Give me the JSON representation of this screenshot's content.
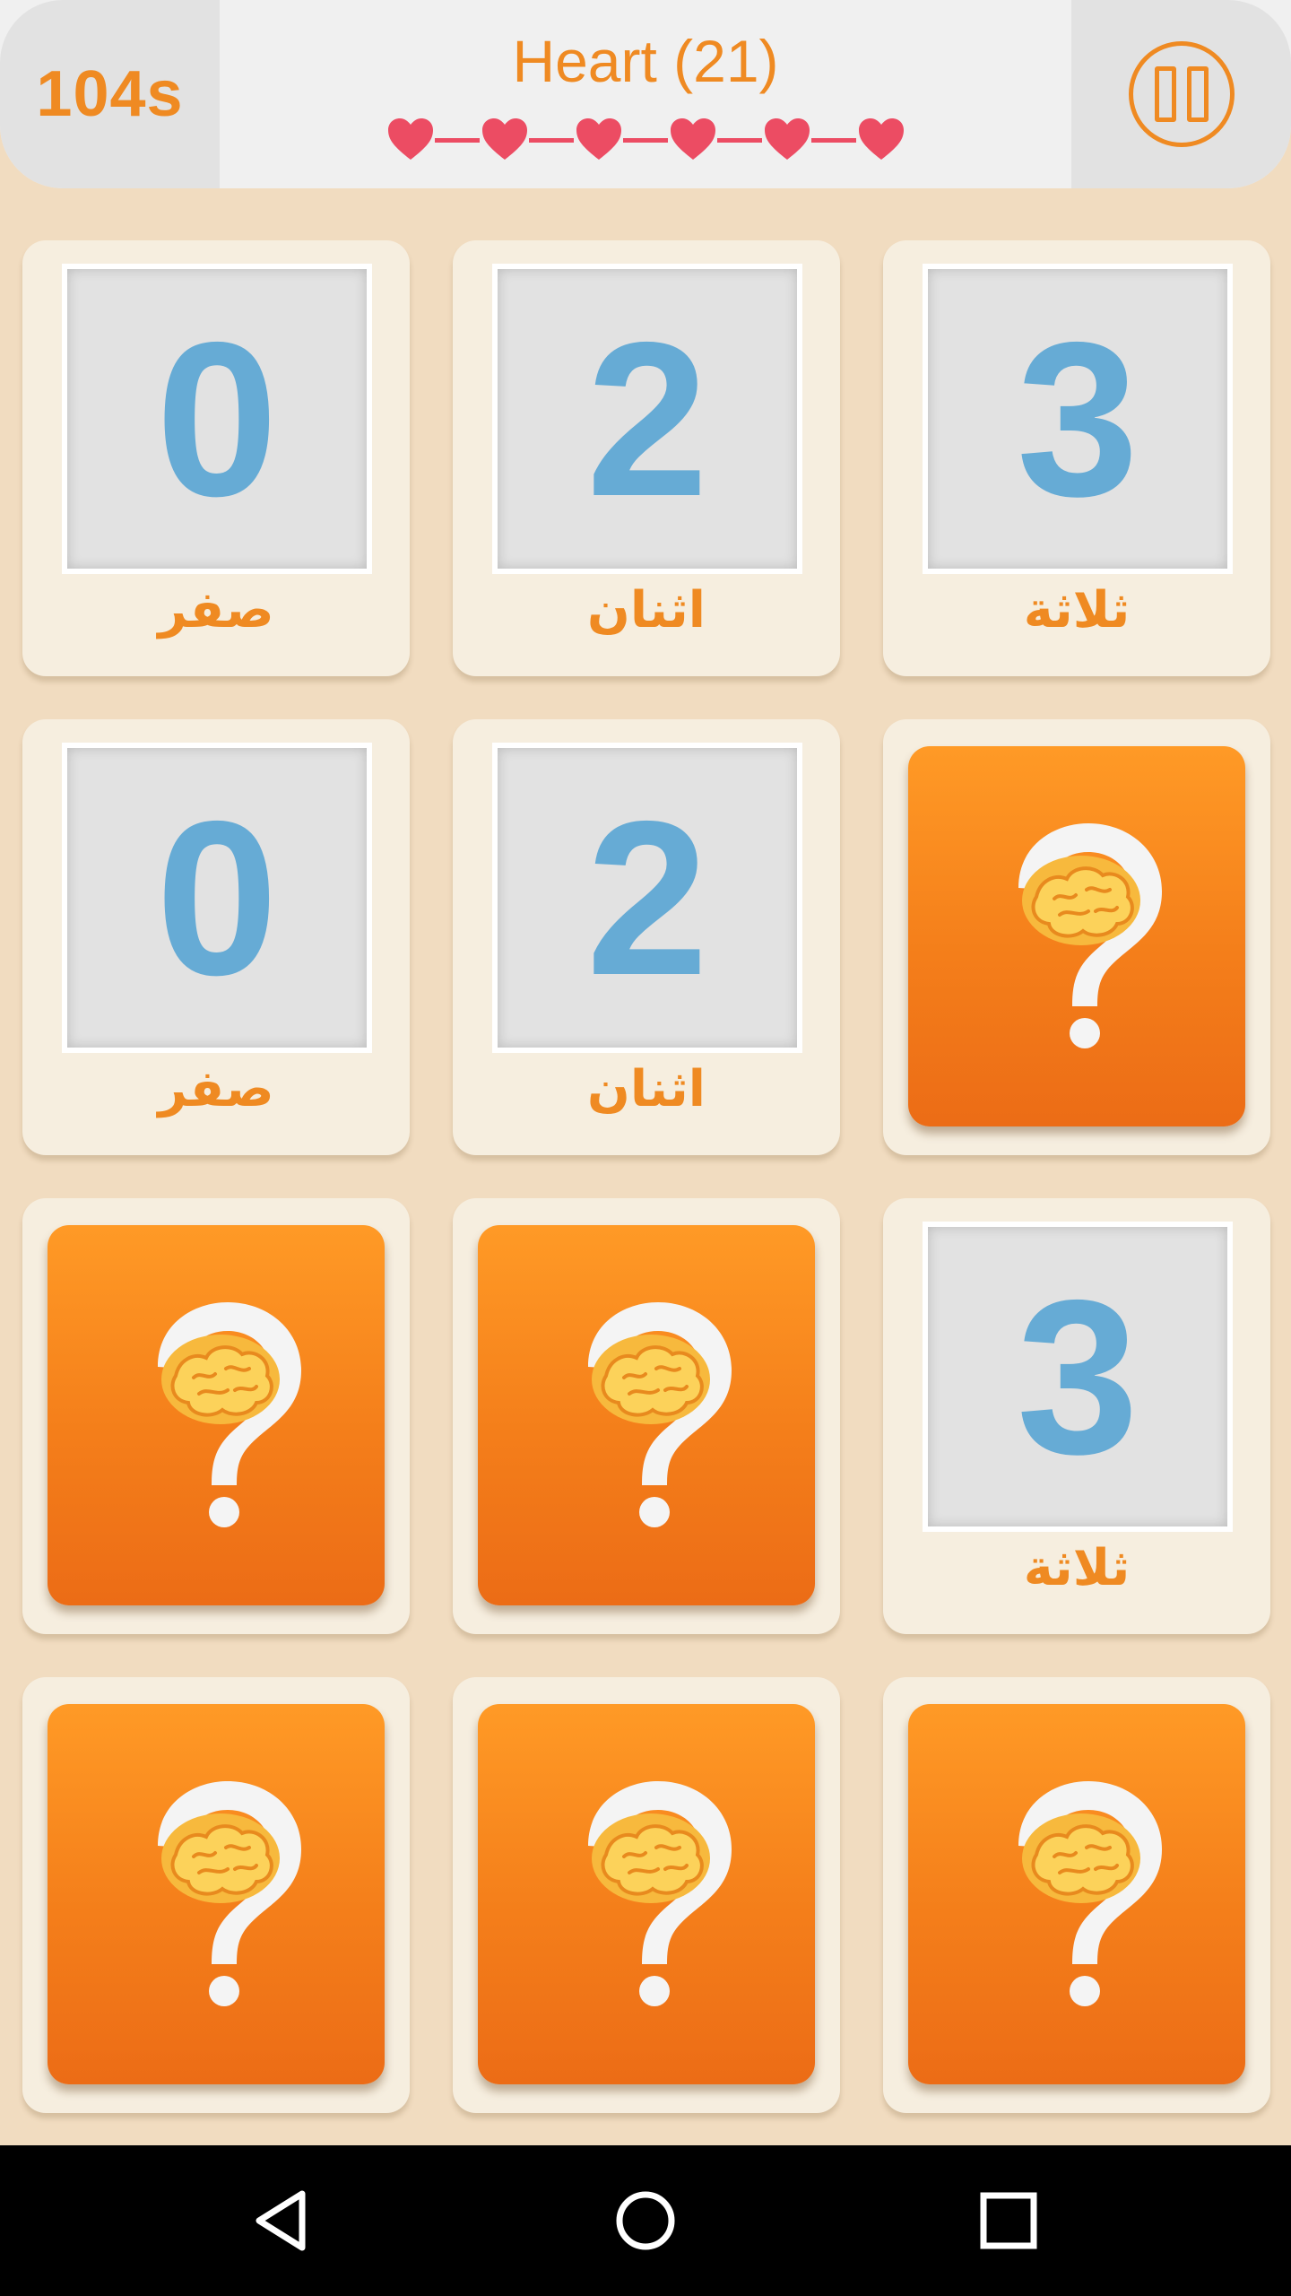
{
  "header": {
    "timer": "104s",
    "title": "Heart (21)",
    "lives_count": 6,
    "heart_color": "#ec4c63",
    "accent_color": "#ef8a22",
    "pause_icon": "pause-icon"
  },
  "board": {
    "rows": 4,
    "columns": 3,
    "cards": [
      {
        "state": "face-up",
        "digit": "0",
        "word": "صفر"
      },
      {
        "state": "face-up",
        "digit": "2",
        "word": "اثنان"
      },
      {
        "state": "face-up",
        "digit": "3",
        "word": "ثلاثة"
      },
      {
        "state": "face-up",
        "digit": "0",
        "word": "صفر"
      },
      {
        "state": "face-up",
        "digit": "2",
        "word": "اثنان"
      },
      {
        "state": "face-down",
        "icon": "brain-question-icon"
      },
      {
        "state": "face-down",
        "icon": "brain-question-icon"
      },
      {
        "state": "face-down",
        "icon": "brain-question-icon"
      },
      {
        "state": "face-up",
        "digit": "3",
        "word": "ثلاثة"
      },
      {
        "state": "face-down",
        "icon": "brain-question-icon"
      },
      {
        "state": "face-down",
        "icon": "brain-question-icon"
      },
      {
        "state": "face-down",
        "icon": "brain-question-icon"
      }
    ],
    "card_back_color": "#f47e1a",
    "digit_color": "#66abd5"
  },
  "navbar": {
    "buttons": [
      "back-icon",
      "home-icon",
      "recents-icon"
    ]
  }
}
